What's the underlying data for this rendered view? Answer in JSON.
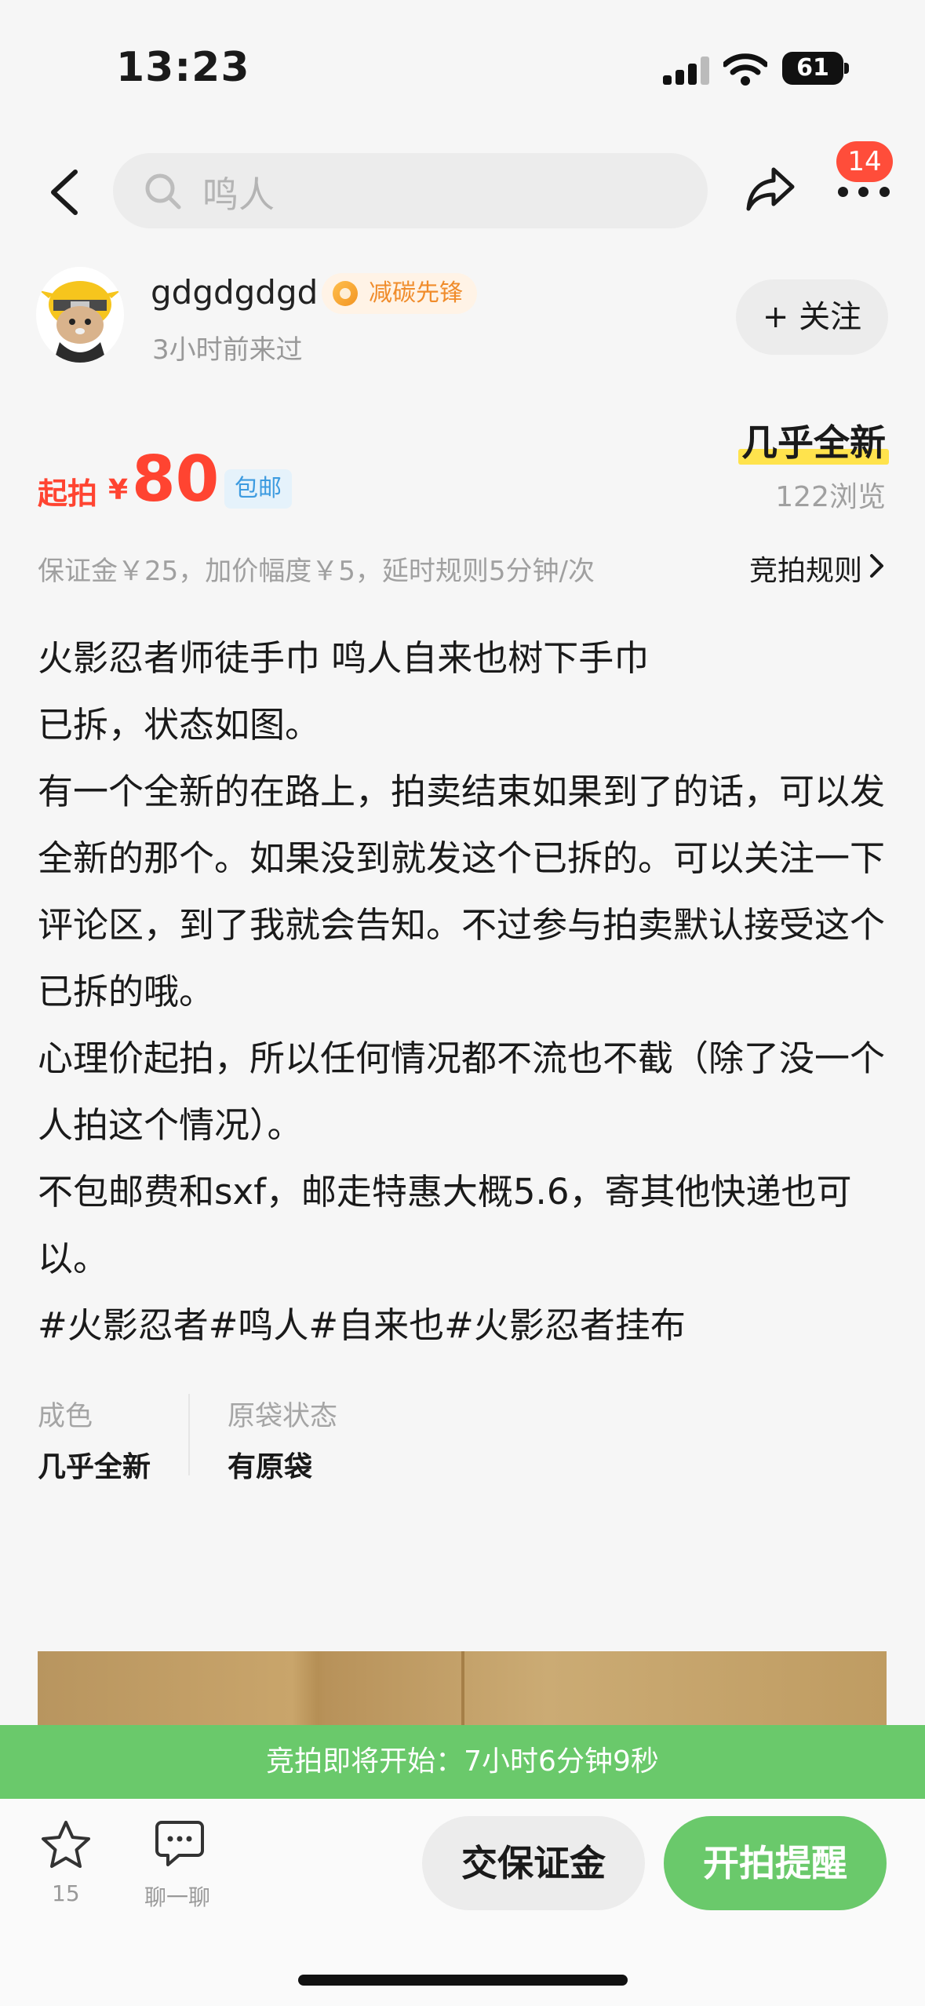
{
  "status_bar": {
    "time": "13:23",
    "battery": "61"
  },
  "nav": {
    "search_placeholder": "鸣人",
    "notification_count": "14"
  },
  "seller": {
    "name": "gdgdgdgd",
    "badge": "减碳先锋",
    "last_seen": "3小时前来过",
    "follow_label": "+ 关注"
  },
  "price": {
    "start_label": "起拍",
    "currency": "¥",
    "amount": "80",
    "shipping_tag": "包邮",
    "condition_tag": "几乎全新",
    "views": "122浏览"
  },
  "rules": {
    "info": "保证金￥25，加价幅度￥5，延时规则5分钟/次",
    "link_label": "竞拍规则"
  },
  "description": {
    "lines": [
      "火影忍者师徒手巾 鸣人自来也树下手巾",
      "已拆，状态如图。",
      "有一个全新的在路上，拍卖结束如果到了的话，可以发全新的那个。如果没到就发这个已拆的。可以关注一下评论区，到了我就会告知。不过参与拍卖默认接受这个已拆的哦。",
      "心理价起拍，所以任何情况都不流也不截（除了没一个人拍这个情况）。",
      "不包邮费和sxf，邮走特惠大概5.6，寄其他快递也可以。",
      "#火影忍者#鸣人#自来也#火影忍者挂布"
    ]
  },
  "attributes": [
    {
      "label": "成色",
      "value": "几乎全新"
    },
    {
      "label": "原袋状态",
      "value": "有原袋"
    }
  ],
  "countdown": "竞拍即将开始：7小时6分钟9秒",
  "bottom_bar": {
    "favorite_count": "15",
    "chat_label": "聊一聊",
    "deposit_label": "交保证金",
    "remind_label": "开拍提醒"
  },
  "colors": {
    "accent_red": "#ff4431",
    "accent_green": "#6ac96b",
    "highlight_yellow": "#ffe34d"
  }
}
